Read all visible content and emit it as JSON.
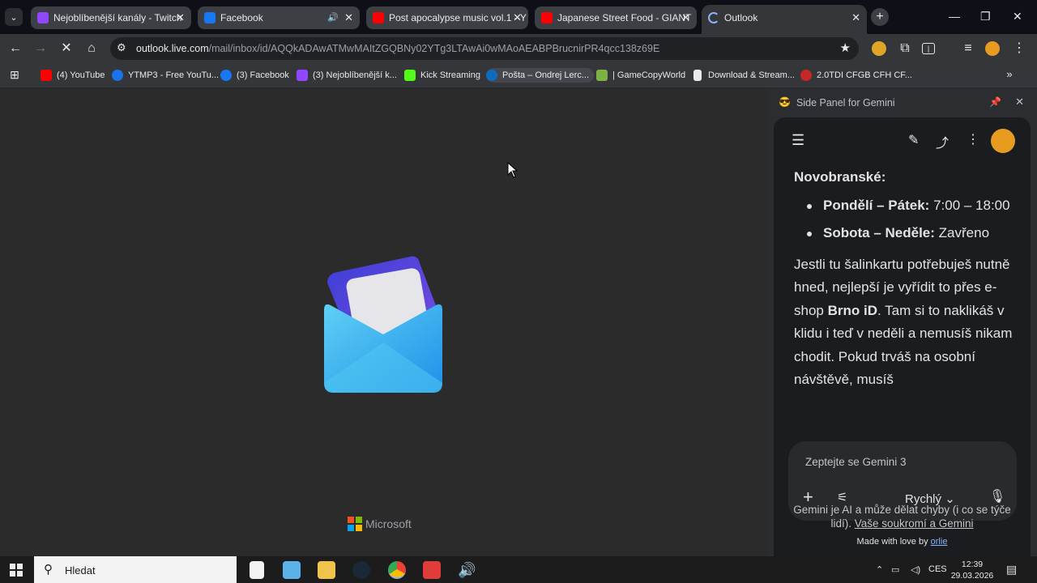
{
  "tabs": [
    {
      "title": "Nejoblíbenější kanály - Twitch",
      "icon": "twitch-icon",
      "color": "#9146ff",
      "active": false
    },
    {
      "title": "Facebook",
      "icon": "facebook-icon",
      "color": "#1877f2",
      "active": false,
      "audio": true
    },
    {
      "title": "Post apocalypse music vol.1 - Y",
      "icon": "youtube-icon",
      "color": "#ff0000",
      "active": false
    },
    {
      "title": "Japanese Street Food - GIANT",
      "icon": "youtube-icon",
      "color": "#ff0000",
      "active": false
    },
    {
      "title": "Outlook",
      "icon": "loading-icon",
      "color": "#8ab4f8",
      "active": true
    }
  ],
  "toolbar": {
    "url_host": "outlook.live.com",
    "url_path": "/mail/inbox/id/AQQkADAwATMwMAItZGQBNy02YTg3LTAwAi0wMAoAEABPBrucnirPR4qcc138z69E"
  },
  "bookmarks": [
    {
      "label": "(4) YouTube",
      "color": "#ff0000"
    },
    {
      "label": "YTMP3 - Free YouTu...",
      "color": "#1a73e8"
    },
    {
      "label": "(3) Facebook",
      "color": "#1877f2"
    },
    {
      "label": "(3) Nejoblíbenější k...",
      "color": "#9146ff"
    },
    {
      "label": "Kick Streaming",
      "color": "#53fc18"
    },
    {
      "label": "Pošta – Ondrej Lerc...",
      "color": "#0f6cbd"
    },
    {
      "label": "| GameCopyWorld",
      "color": "#7cb342"
    },
    {
      "label": "Download & Stream...",
      "color": "#e8eaed"
    },
    {
      "label": "2.0TDI CFGB CFH CF...",
      "color": "#c62828"
    }
  ],
  "splash": {
    "brand": "Microsoft"
  },
  "side_panel": {
    "title": "Side Panel for Gemini",
    "heading": "Novobranské:",
    "hours": [
      {
        "label": "Pondělí – Pátek:",
        "value": "7:00 – 18:00"
      },
      {
        "label": "Sobota – Neděle:",
        "value": "Zavřeno"
      }
    ],
    "para_before": "Jestli tu šalinkartu potřebuješ nutně hned, nejlepší je vyřídit to přes e-shop ",
    "para_bold": "Brno iD",
    "para_after": ". Tam si to naklikáš v klidu i teď v neděli a nemusíš nikam chodit. Pokud trváš na osobní návštěvě, musíš",
    "composer_placeholder": "Zeptejte se Gemini 3",
    "mode": "Rychlý",
    "disclaimer": "Gemini je AI a může dělat chyby (i co se týče lidí). ",
    "privacy_link": "Vaše soukromí a Gemini",
    "made_with": "Made with love by ",
    "author": "orlie"
  },
  "taskbar": {
    "search_label": "Hledat",
    "lang": "CES",
    "time": "12:39",
    "date": "29.03.2026"
  }
}
